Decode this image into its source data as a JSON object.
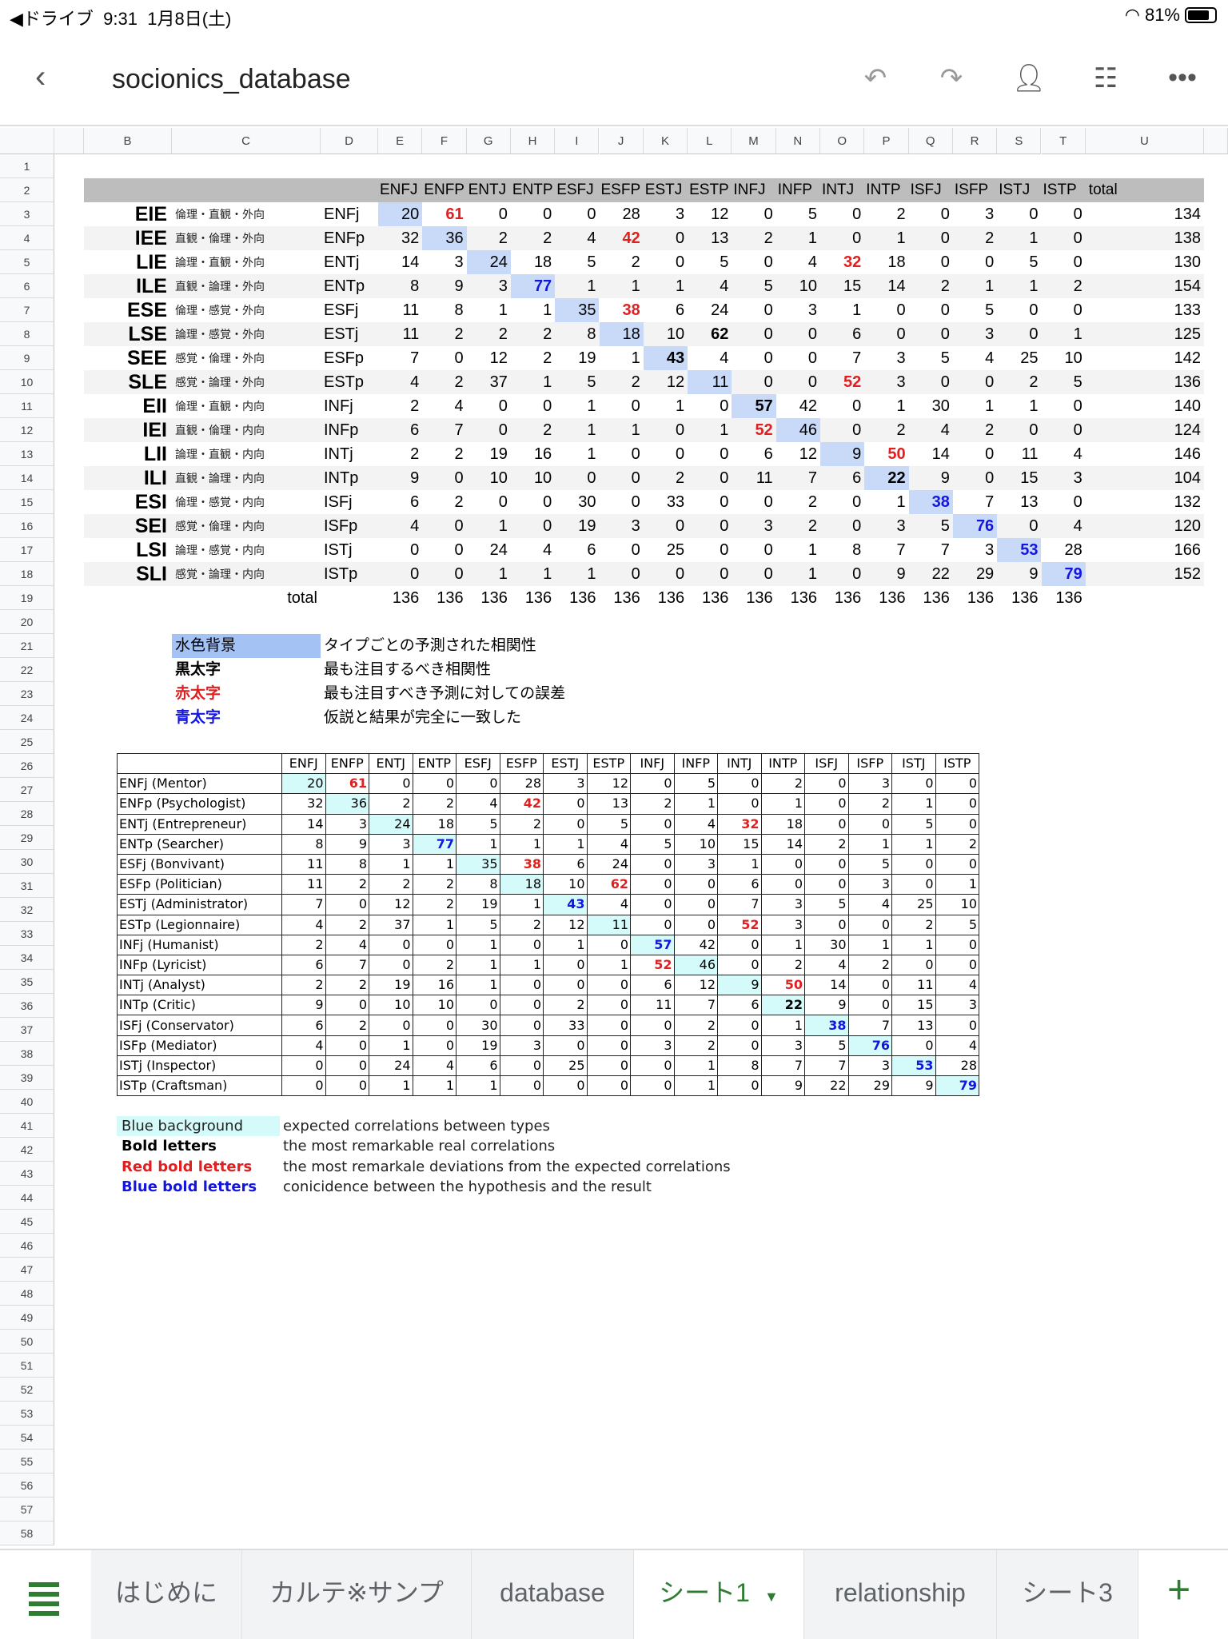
{
  "status": {
    "back": "◀ドライブ",
    "time": "9:31",
    "date": "1月8日(土)",
    "wifi": "wifi-icon",
    "battery": "81%",
    "battery_level": 0.81
  },
  "header": {
    "title": "socionics_database"
  },
  "column_letters": [
    "B",
    "C",
    "D",
    "E",
    "F",
    "G",
    "H",
    "I",
    "J",
    "K",
    "L",
    "M",
    "N",
    "O",
    "P",
    "Q",
    "R",
    "S",
    "T",
    "U"
  ],
  "row_numbers": [
    1,
    2,
    3,
    4,
    5,
    6,
    7,
    8,
    9,
    10,
    11,
    12,
    13,
    14,
    15,
    16,
    17,
    18,
    19,
    20,
    21,
    22,
    23,
    24,
    25,
    26,
    27,
    28,
    29,
    30,
    31,
    32,
    33,
    34,
    35,
    36,
    37,
    38,
    39,
    40,
    41,
    42,
    43,
    44,
    45,
    46,
    47,
    48,
    49,
    50,
    51,
    52,
    53,
    54,
    55,
    56,
    57,
    58
  ],
  "table1": {
    "headers": [
      "ENFJ",
      "ENFP",
      "ENTJ",
      "ENTP",
      "ESFJ",
      "ESFP",
      "ESTJ",
      "ESTP",
      "INFJ",
      "INFP",
      "INTJ",
      "INTP",
      "ISFJ",
      "ISFP",
      "ISTJ",
      "ISTP"
    ],
    "total_header": "total",
    "rows": [
      {
        "code": "EIE",
        "desc": "倫理・直観・外向",
        "type": "ENFj",
        "values": [
          20,
          61,
          0,
          0,
          0,
          28,
          3,
          12,
          0,
          5,
          0,
          2,
          0,
          3,
          0,
          0
        ],
        "total": 134
      },
      {
        "code": "IEE",
        "desc": "直観・倫理・外向",
        "type": "ENFp",
        "values": [
          32,
          36,
          2,
          2,
          4,
          42,
          0,
          13,
          2,
          1,
          0,
          1,
          0,
          2,
          1,
          0
        ],
        "total": 138
      },
      {
        "code": "LIE",
        "desc": "論理・直観・外向",
        "type": "ENTj",
        "values": [
          14,
          3,
          24,
          18,
          5,
          2,
          0,
          5,
          0,
          4,
          32,
          18,
          0,
          0,
          5,
          0
        ],
        "total": 130
      },
      {
        "code": "ILE",
        "desc": "直観・論理・外向",
        "type": "ENTp",
        "values": [
          8,
          9,
          3,
          77,
          1,
          1,
          1,
          4,
          5,
          10,
          15,
          14,
          2,
          1,
          1,
          2
        ],
        "total": 154
      },
      {
        "code": "ESE",
        "desc": "倫理・感覚・外向",
        "type": "ESFj",
        "values": [
          11,
          8,
          1,
          1,
          35,
          38,
          6,
          24,
          0,
          3,
          1,
          0,
          0,
          5,
          0,
          0
        ],
        "total": 133
      },
      {
        "code": "LSE",
        "desc": "論理・感覚・外向",
        "type": "ESTj",
        "values": [
          11,
          2,
          2,
          2,
          8,
          18,
          10,
          62,
          0,
          0,
          6,
          0,
          0,
          3,
          0,
          1
        ],
        "total": 125
      },
      {
        "code": "SEE",
        "desc": "感覚・倫理・外向",
        "type": "ESFp",
        "values": [
          7,
          0,
          12,
          2,
          19,
          1,
          43,
          4,
          0,
          0,
          7,
          3,
          5,
          4,
          25,
          10
        ],
        "total": 142
      },
      {
        "code": "SLE",
        "desc": "感覚・論理・外向",
        "type": "ESTp",
        "values": [
          4,
          2,
          37,
          1,
          5,
          2,
          12,
          11,
          0,
          0,
          52,
          3,
          0,
          0,
          2,
          5
        ],
        "total": 136
      },
      {
        "code": "EII",
        "desc": "倫理・直観・内向",
        "type": "INFj",
        "values": [
          2,
          4,
          0,
          0,
          1,
          0,
          1,
          0,
          57,
          42,
          0,
          1,
          30,
          1,
          1,
          0
        ],
        "total": 140
      },
      {
        "code": "IEI",
        "desc": "直観・倫理・内向",
        "type": "INFp",
        "values": [
          6,
          7,
          0,
          2,
          1,
          1,
          0,
          1,
          52,
          46,
          0,
          2,
          4,
          2,
          0,
          0
        ],
        "total": 124
      },
      {
        "code": "LII",
        "desc": "論理・直観・内向",
        "type": "INTj",
        "values": [
          2,
          2,
          19,
          16,
          1,
          0,
          0,
          0,
          6,
          12,
          9,
          50,
          14,
          0,
          11,
          4
        ],
        "total": 146
      },
      {
        "code": "ILI",
        "desc": "直観・論理・内向",
        "type": "INTp",
        "values": [
          9,
          0,
          10,
          10,
          0,
          0,
          2,
          0,
          11,
          7,
          6,
          22,
          9,
          0,
          15,
          3
        ],
        "total": 104
      },
      {
        "code": "ESI",
        "desc": "倫理・感覚・内向",
        "type": "ISFj",
        "values": [
          6,
          2,
          0,
          0,
          30,
          0,
          33,
          0,
          0,
          2,
          0,
          1,
          38,
          7,
          13,
          0
        ],
        "total": 132
      },
      {
        "code": "SEI",
        "desc": "感覚・倫理・内向",
        "type": "ISFp",
        "values": [
          4,
          0,
          1,
          0,
          19,
          3,
          0,
          0,
          3,
          2,
          0,
          3,
          5,
          76,
          0,
          4
        ],
        "total": 120
      },
      {
        "code": "LSI",
        "desc": "論理・感覚・内向",
        "type": "ISTj",
        "values": [
          0,
          0,
          24,
          4,
          6,
          0,
          25,
          0,
          0,
          1,
          8,
          7,
          7,
          3,
          53,
          28
        ],
        "total": 166
      },
      {
        "code": "SLI",
        "desc": "感覚・論理・内向",
        "type": "ISTp",
        "values": [
          0,
          0,
          1,
          1,
          1,
          0,
          0,
          0,
          0,
          1,
          0,
          9,
          22,
          29,
          9,
          79
        ],
        "total": 152
      }
    ],
    "totals_label": "total",
    "totals": [
      136,
      136,
      136,
      136,
      136,
      136,
      136,
      136,
      136,
      136,
      136,
      136,
      136,
      136,
      136,
      136
    ],
    "styles": {
      "red": [
        [
          0,
          1
        ],
        [
          1,
          5
        ],
        [
          2,
          10
        ],
        [
          4,
          5
        ],
        [
          7,
          10
        ],
        [
          9,
          8
        ],
        [
          10,
          11
        ]
      ],
      "bold": [
        [
          5,
          7
        ],
        [
          6,
          6
        ],
        [
          8,
          8
        ],
        [
          11,
          11
        ]
      ],
      "blue": [
        [
          3,
          3
        ],
        [
          12,
          12
        ],
        [
          13,
          13
        ],
        [
          14,
          14
        ],
        [
          15,
          15
        ]
      ]
    },
    "highlight_color": "#c9daf8"
  },
  "legend_jp": [
    {
      "key": "水色背景",
      "desc": "タイプごとの予測された相関性",
      "style": "hl"
    },
    {
      "key": "黒太字",
      "desc": "最も注目するべき相関性",
      "style": "bold"
    },
    {
      "key": "赤太字",
      "desc": "最も注目すべき予測に対しての誤差",
      "style": "red"
    },
    {
      "key": "青太字",
      "desc": "仮説と結果が完全に一致した",
      "style": "blue"
    }
  ],
  "table2": {
    "headers": [
      "ENFJ",
      "ENFP",
      "ENTJ",
      "ENTP",
      "ESFJ",
      "ESFP",
      "ESTJ",
      "ESTP",
      "INFJ",
      "INFP",
      "INTJ",
      "INTP",
      "ISFJ",
      "ISFP",
      "ISTJ",
      "ISTP"
    ],
    "labels": [
      "ENFj (Mentor)",
      "ENFp (Psychologist)",
      "ENTj (Entrepreneur)",
      "ENTp (Searcher)",
      "ESFj (Bonvivant)",
      "ESFp (Politician)",
      "ESTj (Administrator)",
      "ESTp (Legionnaire)",
      "INFj (Humanist)",
      "INFp (Lyricist)",
      "INTj (Analyst)",
      "INTp (Critic)",
      "ISFj (Conservator)",
      "ISFp (Mediator)",
      "ISTj (Inspector)",
      "ISTp (Craftsman)"
    ],
    "rows": [
      [
        20,
        61,
        0,
        0,
        0,
        28,
        3,
        12,
        0,
        5,
        0,
        2,
        0,
        3,
        0,
        0
      ],
      [
        32,
        36,
        2,
        2,
        4,
        42,
        0,
        13,
        2,
        1,
        0,
        1,
        0,
        2,
        1,
        0
      ],
      [
        14,
        3,
        24,
        18,
        5,
        2,
        0,
        5,
        0,
        4,
        32,
        18,
        0,
        0,
        5,
        0
      ],
      [
        8,
        9,
        3,
        77,
        1,
        1,
        1,
        4,
        5,
        10,
        15,
        14,
        2,
        1,
        1,
        2
      ],
      [
        11,
        8,
        1,
        1,
        35,
        38,
        6,
        24,
        0,
        3,
        1,
        0,
        0,
        5,
        0,
        0
      ],
      [
        11,
        2,
        2,
        2,
        8,
        18,
        10,
        62,
        0,
        0,
        6,
        0,
        0,
        3,
        0,
        1
      ],
      [
        7,
        0,
        12,
        2,
        19,
        1,
        43,
        4,
        0,
        0,
        7,
        3,
        5,
        4,
        25,
        10
      ],
      [
        4,
        2,
        37,
        1,
        5,
        2,
        12,
        11,
        0,
        0,
        52,
        3,
        0,
        0,
        2,
        5
      ],
      [
        2,
        4,
        0,
        0,
        1,
        0,
        1,
        0,
        57,
        42,
        0,
        1,
        30,
        1,
        1,
        0
      ],
      [
        6,
        7,
        0,
        2,
        1,
        1,
        0,
        1,
        52,
        46,
        0,
        2,
        4,
        2,
        0,
        0
      ],
      [
        2,
        2,
        19,
        16,
        1,
        0,
        0,
        0,
        6,
        12,
        9,
        50,
        14,
        0,
        11,
        4
      ],
      [
        9,
        0,
        10,
        10,
        0,
        0,
        2,
        0,
        11,
        7,
        6,
        22,
        9,
        0,
        15,
        3
      ],
      [
        6,
        2,
        0,
        0,
        30,
        0,
        33,
        0,
        0,
        2,
        0,
        1,
        38,
        7,
        13,
        0
      ],
      [
        4,
        0,
        1,
        0,
        19,
        3,
        0,
        0,
        3,
        2,
        0,
        3,
        5,
        76,
        0,
        4
      ],
      [
        0,
        0,
        24,
        4,
        6,
        0,
        25,
        0,
        0,
        1,
        8,
        7,
        7,
        3,
        53,
        28
      ],
      [
        0,
        0,
        1,
        1,
        1,
        0,
        0,
        0,
        0,
        1,
        0,
        9,
        22,
        29,
        9,
        79
      ]
    ],
    "styles": {
      "red": [
        [
          0,
          1
        ],
        [
          1,
          5
        ],
        [
          2,
          10
        ],
        [
          4,
          5
        ],
        [
          5,
          7
        ],
        [
          7,
          10
        ],
        [
          9,
          8
        ],
        [
          10,
          11
        ]
      ],
      "bold": [
        [
          11,
          11
        ]
      ],
      "blue": [
        [
          3,
          3
        ],
        [
          6,
          6
        ],
        [
          8,
          8
        ],
        [
          12,
          12
        ],
        [
          13,
          13
        ],
        [
          14,
          14
        ],
        [
          15,
          15
        ]
      ]
    },
    "highlight_color": "#d4fafa"
  },
  "legend_en": [
    {
      "key": "Blue background",
      "desc": "expected correlations between types",
      "style": "hl"
    },
    {
      "key": "Bold letters",
      "desc": "the most remarkable real correlations",
      "style": "bold"
    },
    {
      "key": "Red bold letters",
      "desc": "the most remarkale deviations from the expected correlations",
      "style": "red"
    },
    {
      "key": "Blue bold letters",
      "desc": "conicidence between the hypothesis and the result",
      "style": "blue"
    }
  ],
  "tabs": [
    {
      "label": "はじめに"
    },
    {
      "label": "カルテ※サンプ"
    },
    {
      "label": "database"
    },
    {
      "label": "シート1",
      "active": true,
      "dropdown": "▼"
    },
    {
      "label": "relationship"
    },
    {
      "label": "シート3"
    }
  ],
  "accent": "#2e7d32"
}
